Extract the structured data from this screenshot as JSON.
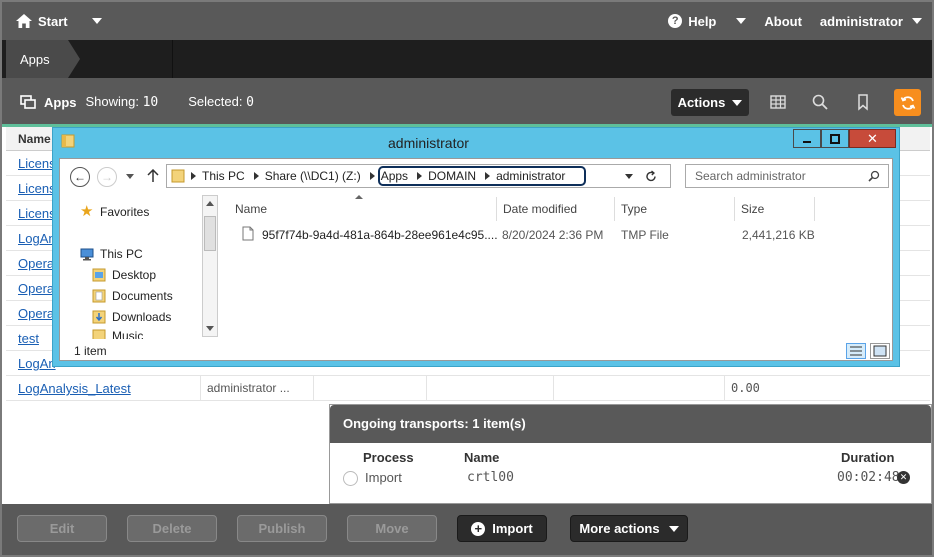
{
  "topbar": {
    "start_label": "Start",
    "help_label": "Help",
    "about_label": "About",
    "user_label": "administrator"
  },
  "breadcrumb": {
    "apps": "Apps"
  },
  "toolbar": {
    "title": "Apps",
    "showing_label": "Showing:",
    "showing_count": "10",
    "selected_label": "Selected:",
    "selected_count": "0",
    "actions_label": "Actions"
  },
  "table": {
    "name_header": "Name",
    "rows": [
      {
        "name": "Licens"
      },
      {
        "name": "Licens"
      },
      {
        "name": "Licens"
      },
      {
        "name": "LogAn"
      },
      {
        "name": "Opera"
      },
      {
        "name": "Opera"
      },
      {
        "name": "Opera"
      },
      {
        "name": "test"
      },
      {
        "name": "LogAn"
      },
      {
        "name": "LogAnalysis_Latest",
        "owner": "administrator ...",
        "size": "0.00"
      }
    ]
  },
  "explorer": {
    "title": "administrator",
    "address": {
      "this_pc": "This PC",
      "share": "Share (\\\\DC1) (Z:)",
      "apps": "Apps",
      "domain": "DOMAIN",
      "admin": "administrator"
    },
    "search_placeholder": "Search administrator",
    "nav": {
      "favorites": "Favorites",
      "this_pc": "This PC",
      "desktop": "Desktop",
      "documents": "Documents",
      "downloads": "Downloads",
      "music": "Music"
    },
    "columns": {
      "name": "Name",
      "date": "Date modified",
      "type": "Type",
      "size": "Size"
    },
    "file": {
      "name": "95f7f74b-9a4d-481a-864b-28ee961e4c95....",
      "date": "8/20/2024 2:36 PM",
      "type": "TMP File",
      "size": "2,441,216 KB"
    },
    "status": "1 item"
  },
  "transports": {
    "header": "Ongoing transports: 1 item(s)",
    "col_process": "Process",
    "col_name": "Name",
    "col_duration": "Duration",
    "process": "Import",
    "name": "crtl00",
    "duration": "00:02:48"
  },
  "bottombar": {
    "edit": "Edit",
    "delete": "Delete",
    "publish": "Publish",
    "move": "Move",
    "import": "Import",
    "more_actions": "More actions"
  },
  "colors": {
    "header_gray": "#595959",
    "accent_orange": "#f78e1e",
    "accent_green": "#5fbf9a",
    "explorer_blue": "#5bc2e6",
    "link_blue": "#1a5fb4"
  }
}
